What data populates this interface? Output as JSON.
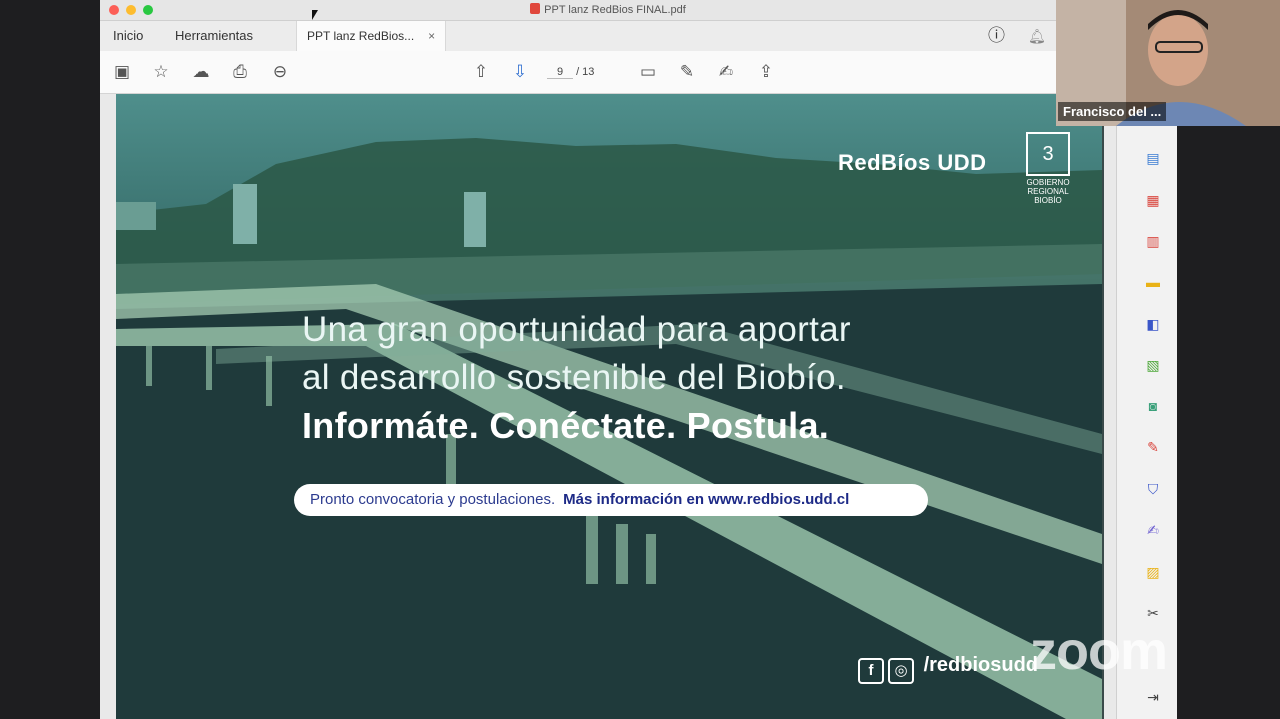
{
  "window": {
    "title": "PPT lanz RedBios FINAL.pdf",
    "traffic_colors": [
      "#fc5f57",
      "#fdbc2e",
      "#29c841"
    ]
  },
  "tabs": [
    {
      "label": "Inicio"
    },
    {
      "label": "Herramientas"
    },
    {
      "label": "PPT lanz RedBios...",
      "close": "×"
    }
  ],
  "toolbar": {
    "page_current": "9",
    "page_total": "/ 13"
  },
  "slide": {
    "logo": "RedBíos UDD",
    "gov_seal": "GOBIERNO REGIONAL BIOBÍO",
    "headline_line1": "Una gran oportunidad para aportar",
    "headline_line2": "al desarrollo sostenible del Biobío.",
    "headline_bold": "Informáte. Conéctate. Postula.",
    "pill_text": "Pronto convocatoria y postulaciones.",
    "pill_link": "Más información en www.redbios.udd.cl",
    "social_handle": "/redbiosudd"
  },
  "video": {
    "participant_name": "Francisco del ..."
  },
  "watermark": "zoom",
  "icons": [
    "save-icon",
    "star-icon",
    "upload-cloud-icon",
    "print-icon",
    "zoom-out-icon",
    "page-up-icon",
    "page-down-icon",
    "comment-icon",
    "pen-icon",
    "sign-icon",
    "share-icon",
    "help-icon",
    "bell-icon"
  ]
}
